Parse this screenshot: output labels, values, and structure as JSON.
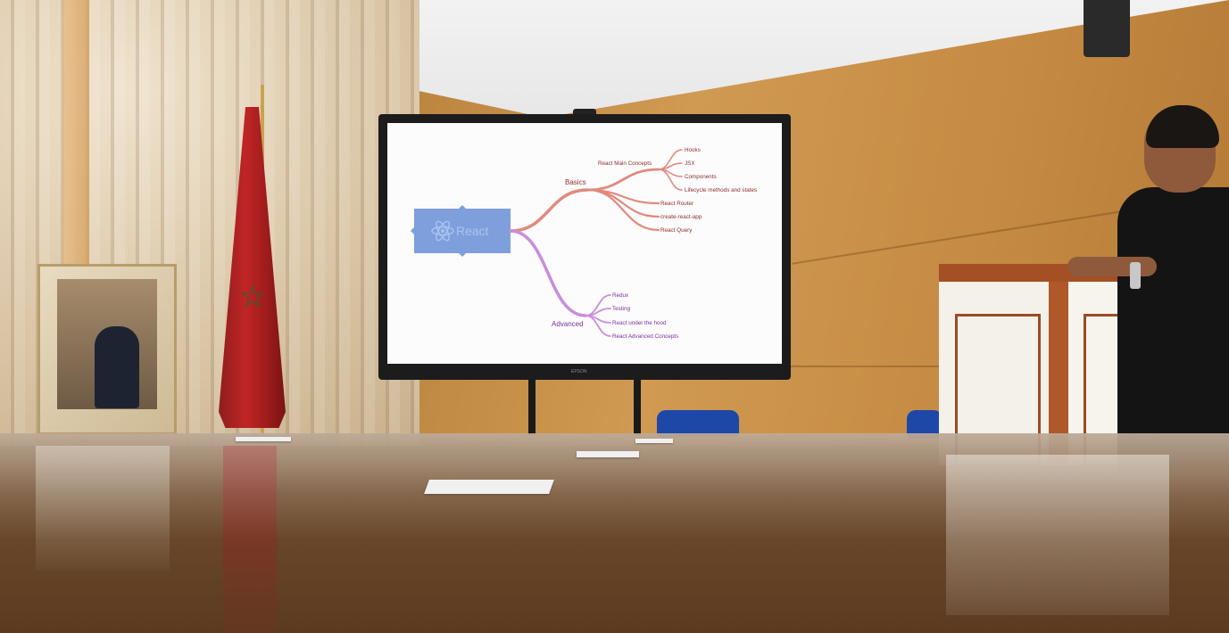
{
  "mindmap": {
    "root": "React",
    "basics": {
      "label": "Basics",
      "main_concepts": {
        "label": "React Main Concepts",
        "items": [
          "Hooks",
          "JSX",
          "Components",
          "Lifecycle methods and states"
        ]
      },
      "items": [
        "React Router",
        "create-react-app",
        "React Query"
      ]
    },
    "advanced": {
      "label": "Advanced",
      "items": [
        "Redux",
        "Testing",
        "React under the hood",
        "React Advanced Concepts"
      ]
    },
    "colors": {
      "root_box": "#7f9fdc",
      "root_text": "#a9c3f2",
      "basics_branch": "#e08a7e",
      "advanced_branch": "#c98ddc",
      "basics_text": "#8c2f2a",
      "advanced_text": "#7a2f9a"
    }
  },
  "scene": {
    "tv_brand": "EPSON"
  }
}
